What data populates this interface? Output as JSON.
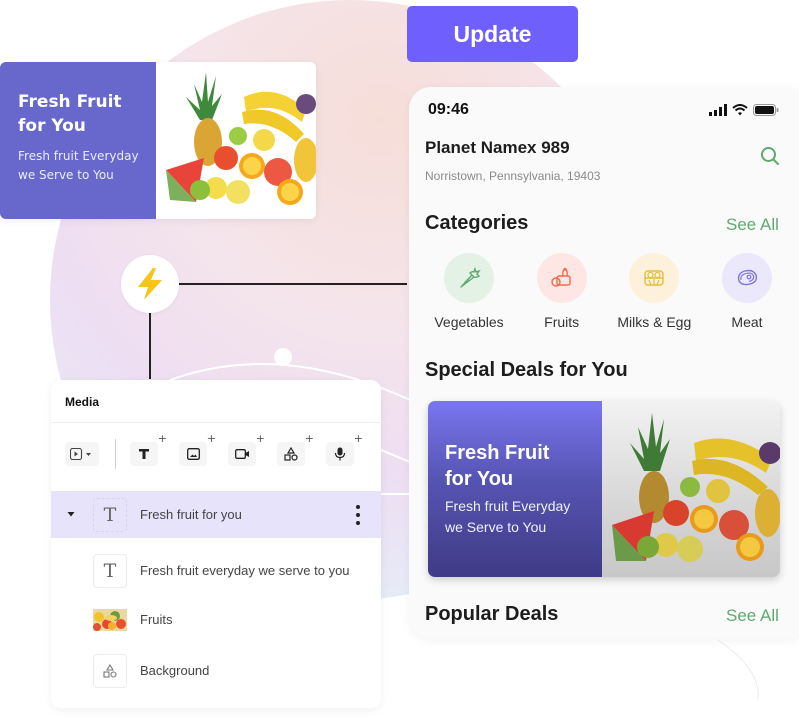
{
  "banner_preview": {
    "title_line1": "Fresh Fruit",
    "title_line2": "for You",
    "subtitle_line1": "Fresh fruit Everyday",
    "subtitle_line2": "we Serve to You",
    "image": "fruit-basket-image"
  },
  "update_button": {
    "label": "Update"
  },
  "connector_node": {
    "icon": "lightning-bolt-icon"
  },
  "phone": {
    "status_bar": {
      "time": "09:46",
      "icons": [
        "cellular-signal-icon",
        "wifi-icon",
        "battery-icon"
      ]
    },
    "store": {
      "name": "Planet Namex 989",
      "address": "Norristown, Pennsylvania, 19403"
    },
    "search_icon": "search-icon",
    "categories_section": {
      "title": "Categories",
      "see_all": "See All",
      "items": [
        {
          "label": "Vegetables",
          "icon": "carrot-icon",
          "bg": "#e4f2e6",
          "fg": "#5fa96e"
        },
        {
          "label": "Fruits",
          "icon": "fruit-basket-icon",
          "bg": "#fde6e3",
          "fg": "#ec6a4a"
        },
        {
          "label": "Milks & Egg",
          "icon": "egg-carton-icon",
          "bg": "#fdf1dc",
          "fg": "#e4c03a"
        },
        {
          "label": "Meat",
          "icon": "steak-icon",
          "bg": "#ebe8fb",
          "fg": "#7d74d9"
        }
      ]
    },
    "special_deals": {
      "title": "Special Deals for You",
      "card": {
        "title_line1": "Fresh Fruit",
        "title_line2": "for You",
        "subtitle_line1": "Fresh fruit Everyday",
        "subtitle_line2": "we Serve to You"
      }
    },
    "popular_deals": {
      "title": "Popular Deals",
      "see_all": "See All"
    }
  },
  "media_panel": {
    "title": "Media",
    "toolbar": [
      {
        "name": "media-type-dropdown",
        "icon": "play-square-icon"
      },
      {
        "name": "add-text",
        "icon": "text-icon",
        "plus": "+"
      },
      {
        "name": "add-image",
        "icon": "image-icon",
        "plus": "+"
      },
      {
        "name": "add-video",
        "icon": "video-camera-icon",
        "plus": "+"
      },
      {
        "name": "add-shape",
        "icon": "shapes-icon",
        "plus": "+"
      },
      {
        "name": "add-audio",
        "icon": "microphone-icon",
        "plus": "+"
      }
    ],
    "layers": [
      {
        "label": "Fresh fruit for you",
        "type": "text",
        "selected": true,
        "expanded": true
      },
      {
        "label": "Fresh fruit everyday we serve to you",
        "type": "text",
        "selected": false
      },
      {
        "label": "Fruits",
        "type": "image",
        "selected": false
      },
      {
        "label": "Background",
        "type": "shape",
        "selected": false
      }
    ]
  },
  "colors": {
    "brand_purple": "#6f5ffd",
    "banner_purple": "#6868cc",
    "accent_green": "#5fa96e",
    "bolt_yellow": "#f5c518",
    "selected_layer": "#e6e3fb"
  }
}
